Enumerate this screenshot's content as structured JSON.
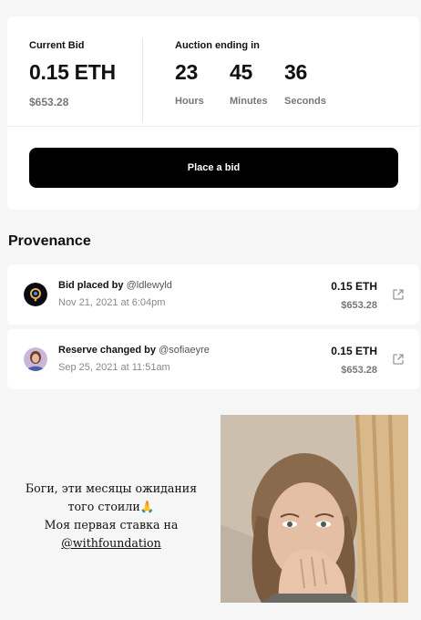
{
  "auction": {
    "current_bid_label": "Current Bid",
    "current_bid": "0.15 ETH",
    "current_bid_usd": "$653.28",
    "ending_label": "Auction ending in",
    "hours": "23",
    "hours_label": "Hours",
    "minutes": "45",
    "minutes_label": "Minutes",
    "seconds": "36",
    "seconds_label": "Seconds",
    "place_bid_label": "Place a bid"
  },
  "provenance": {
    "title": "Provenance",
    "items": [
      {
        "action": "Bid placed by",
        "handle": "@ldlewyld",
        "date": "Nov 21, 2021 at 6:04pm",
        "eth": "0.15 ETH",
        "usd": "$653.28",
        "avatar_icon": "dark-orb-avatar"
      },
      {
        "action": "Reserve changed by",
        "handle": "@sofiaeyre",
        "date": "Sep 25, 2021 at 11:51am",
        "eth": "0.15 ETH",
        "usd": "$653.28",
        "avatar_icon": "portrait-avatar"
      }
    ]
  },
  "caption": {
    "line1": "Боги, эти месяцы ожидания",
    "line2": "того стоили🙏",
    "line3": "Моя первая ставка на",
    "line4": "@withfoundation"
  },
  "colors": {
    "background": "#f6f6f6",
    "card": "#ffffff",
    "button": "#000000",
    "muted_text": "#777777"
  }
}
